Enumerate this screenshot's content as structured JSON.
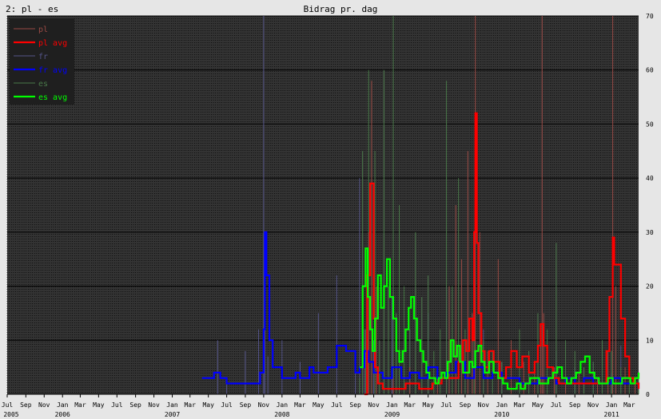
{
  "window": {
    "tab_label": "2: pl - es"
  },
  "chart_data": {
    "type": "line",
    "title": "Bidrag pr. dag",
    "xlabel": "",
    "ylabel": "",
    "ylim": [
      0,
      70
    ],
    "y_ticks": [
      0,
      10,
      20,
      30,
      40,
      50,
      60,
      70
    ],
    "grid": true,
    "legend_position": "top-left",
    "x_start": "2005-07",
    "x_end": "2011-04",
    "month_labels": [
      "Jul",
      "Sep",
      "Nov",
      "Jan",
      "Mar",
      "May",
      "Jul",
      "Sep",
      "Nov",
      "Jan",
      "Mar",
      "May",
      "Jul",
      "Sep",
      "Nov",
      "Jan",
      "Mar",
      "May",
      "Jul",
      "Sep",
      "Nov",
      "Jan",
      "Mar",
      "May",
      "Jul",
      "Sep",
      "Nov",
      "Jan",
      "Mar",
      "May",
      "Jul",
      "Sep",
      "Nov",
      "Jan",
      "Mar"
    ],
    "month_label_dates": [
      "2005-07",
      "2005-09",
      "2005-11",
      "2006-01",
      "2006-03",
      "2006-05",
      "2006-07",
      "2006-09",
      "2006-11",
      "2007-01",
      "2007-03",
      "2007-05",
      "2007-07",
      "2007-09",
      "2007-11",
      "2008-01",
      "2008-03",
      "2008-05",
      "2008-07",
      "2008-09",
      "2008-11",
      "2009-01",
      "2009-03",
      "2009-05",
      "2009-07",
      "2009-09",
      "2009-11",
      "2010-01",
      "2010-03",
      "2010-05",
      "2010-07",
      "2010-09",
      "2010-11",
      "2011-01",
      "2011-03"
    ],
    "year_labels": [
      "2005",
      "2006",
      "2007",
      "2008",
      "2009",
      "2010",
      "2011"
    ],
    "year_label_dates": [
      "2005-07",
      "2006-01",
      "2007-01",
      "2008-01",
      "2009-01",
      "2010-01",
      "2011-01"
    ],
    "colors": {
      "plot_bg": "#333333",
      "grid": "#000000",
      "pl": "#9a4a44",
      "pl_avg": "#ff0000",
      "fr": "#55558a",
      "fr_avg": "#0000ff",
      "es": "#4a7a4a",
      "es_avg": "#00ff00"
    },
    "series": [
      {
        "name": "pl",
        "key": "pl",
        "x": [
          "2008-10-01",
          "2008-10-15",
          "2008-10-25",
          "2008-11-10",
          "2009-01-05",
          "2009-03-01",
          "2009-06-01",
          "2009-07-10",
          "2009-08-01",
          "2009-08-20",
          "2009-09-10",
          "2009-09-25",
          "2009-10-05",
          "2009-10-20",
          "2009-11-15",
          "2009-12-20",
          "2010-02-01",
          "2010-03-15",
          "2010-04-20",
          "2010-05-10",
          "2010-05-15",
          "2010-05-20",
          "2010-06-25",
          "2010-08-01",
          "2010-09-15",
          "2010-11-15",
          "2010-12-20",
          "2011-01-05",
          "2011-01-15",
          "2011-02-15",
          "2011-03-20"
        ],
        "y": [
          0,
          30,
          58,
          20,
          3,
          5,
          3,
          20,
          35,
          25,
          45,
          15,
          70,
          30,
          8,
          25,
          10,
          6,
          5,
          12,
          70,
          15,
          5,
          3,
          4,
          3,
          8,
          70,
          20,
          5,
          3
        ]
      },
      {
        "name": "pl avg",
        "key": "pl_avg",
        "x": [
          "2008-10-01",
          "2008-10-10",
          "2008-10-20",
          "2008-11-01",
          "2008-11-05",
          "2008-11-15",
          "2008-12-01",
          "2009-01-01",
          "2009-02-15",
          "2009-04-01",
          "2009-05-15",
          "2009-06-15",
          "2009-07-15",
          "2009-08-10",
          "2009-08-25",
          "2009-09-05",
          "2009-09-15",
          "2009-09-25",
          "2009-10-01",
          "2009-10-05",
          "2009-10-10",
          "2009-10-15",
          "2009-10-25",
          "2009-11-05",
          "2009-11-20",
          "2009-12-05",
          "2009-12-25",
          "2010-01-15",
          "2010-02-01",
          "2010-02-20",
          "2010-03-10",
          "2010-04-01",
          "2010-04-20",
          "2010-05-01",
          "2010-05-10",
          "2010-05-20",
          "2010-06-01",
          "2010-06-20",
          "2010-07-10",
          "2010-08-01",
          "2010-09-01",
          "2010-10-01",
          "2010-11-01",
          "2010-12-01",
          "2010-12-15",
          "2010-12-25",
          "2011-01-05",
          "2011-01-10",
          "2011-01-20",
          "2011-02-01",
          "2011-02-15",
          "2011-03-01",
          "2011-03-15",
          "2011-04-01"
        ],
        "y": [
          0,
          22,
          39,
          14,
          5,
          2,
          1,
          1,
          2,
          1,
          2,
          3,
          3,
          6,
          10,
          8,
          14,
          10,
          30,
          52,
          28,
          15,
          8,
          5,
          8,
          6,
          3,
          5,
          8,
          5,
          7,
          4,
          6,
          9,
          13,
          9,
          5,
          3,
          2,
          2,
          2,
          2,
          2,
          2,
          8,
          18,
          29,
          24,
          24,
          14,
          7,
          3,
          2,
          1
        ]
      },
      {
        "name": "fr",
        "key": "fr",
        "x": [
          "2007-04-10",
          "2007-06-01",
          "2007-07-01",
          "2007-09-01",
          "2007-10-15",
          "2007-11-01",
          "2007-11-05",
          "2007-11-15",
          "2008-01-01",
          "2008-03-01",
          "2008-05-01",
          "2008-07-01",
          "2008-09-01",
          "2008-09-15",
          "2008-10-01",
          "2008-11-01",
          "2009-01-01",
          "2009-03-01",
          "2009-05-01",
          "2009-07-01",
          "2009-09-01",
          "2009-11-01",
          "2010-01-01",
          "2010-03-01",
          "2010-05-01",
          "2010-07-01",
          "2010-09-01",
          "2010-11-01",
          "2011-01-01",
          "2011-02-01",
          "2011-04-01"
        ],
        "y": [
          0,
          10,
          3,
          8,
          12,
          70,
          12,
          7,
          10,
          6,
          15,
          22,
          8,
          40,
          12,
          10,
          18,
          12,
          15,
          20,
          10,
          12,
          6,
          5,
          4,
          8,
          5,
          6,
          4,
          9,
          3
        ]
      },
      {
        "name": "fr avg",
        "key": "fr_avg",
        "x": [
          "2007-04-10",
          "2007-05-01",
          "2007-05-20",
          "2007-06-10",
          "2007-07-01",
          "2007-08-01",
          "2007-09-01",
          "2007-10-01",
          "2007-10-20",
          "2007-11-01",
          "2007-11-05",
          "2007-11-10",
          "2007-11-20",
          "2007-12-01",
          "2008-01-01",
          "2008-02-01",
          "2008-02-15",
          "2008-03-01",
          "2008-04-01",
          "2008-04-15",
          "2008-05-01",
          "2008-06-01",
          "2008-07-01",
          "2008-07-15",
          "2008-08-01",
          "2008-09-01",
          "2008-09-15",
          "2008-10-01",
          "2008-10-15",
          "2008-11-01",
          "2008-12-01",
          "2009-01-01",
          "2009-02-01",
          "2009-03-01",
          "2009-04-01",
          "2009-05-01",
          "2009-06-01",
          "2009-07-01",
          "2009-08-01",
          "2009-09-01",
          "2009-10-01",
          "2009-11-01",
          "2009-12-01",
          "2010-01-01",
          "2010-02-01",
          "2010-03-01",
          "2010-04-01",
          "2010-05-01",
          "2010-06-01",
          "2010-07-01",
          "2010-08-01",
          "2010-09-01",
          "2010-10-01",
          "2010-11-01",
          "2010-12-01",
          "2011-01-01",
          "2011-02-01",
          "2011-03-01",
          "2011-04-01"
        ],
        "y": [
          3,
          3,
          4,
          3,
          2,
          2,
          2,
          2,
          4,
          12,
          30,
          22,
          10,
          5,
          3,
          3,
          4,
          3,
          5,
          4,
          4,
          5,
          9,
          9,
          8,
          4,
          5,
          8,
          6,
          4,
          3,
          5,
          3,
          4,
          3,
          5,
          3,
          4,
          6,
          3,
          5,
          3,
          4,
          3,
          3,
          2,
          2,
          3,
          3,
          2,
          3,
          2,
          3,
          2,
          2,
          3,
          2,
          2,
          1
        ]
      },
      {
        "name": "es",
        "key": "es",
        "x": [
          "2008-09-15",
          "2008-09-25",
          "2008-10-05",
          "2008-10-15",
          "2008-10-25",
          "2008-11-05",
          "2008-11-20",
          "2008-12-05",
          "2008-12-20",
          "2009-01-05",
          "2009-01-15",
          "2009-01-25",
          "2009-02-10",
          "2009-03-01",
          "2009-03-20",
          "2009-04-10",
          "2009-05-01",
          "2009-05-20",
          "2009-06-10",
          "2009-07-01",
          "2009-07-20",
          "2009-08-10",
          "2009-09-01",
          "2009-10-01",
          "2009-11-01",
          "2009-12-01",
          "2010-01-01",
          "2010-02-01",
          "2010-03-01",
          "2010-04-01",
          "2010-05-01",
          "2010-06-01",
          "2010-07-01",
          "2010-08-01",
          "2010-09-01",
          "2010-10-01",
          "2010-11-01",
          "2010-12-01",
          "2011-01-01",
          "2011-02-01",
          "2011-03-01",
          "2011-04-01"
        ],
        "y": [
          3,
          45,
          12,
          60,
          25,
          45,
          10,
          60,
          20,
          70,
          15,
          35,
          20,
          12,
          30,
          18,
          22,
          8,
          12,
          58,
          20,
          40,
          12,
          15,
          10,
          8,
          6,
          10,
          12,
          8,
          15,
          12,
          28,
          10,
          8,
          5,
          6,
          10,
          8,
          5,
          6,
          4
        ]
      },
      {
        "name": "es avg",
        "key": "es_avg",
        "x": [
          "2008-09-15",
          "2008-09-25",
          "2008-10-05",
          "2008-10-12",
          "2008-10-20",
          "2008-10-28",
          "2008-11-05",
          "2008-11-15",
          "2008-11-25",
          "2008-12-05",
          "2008-12-15",
          "2008-12-25",
          "2009-01-05",
          "2009-01-15",
          "2009-01-25",
          "2009-02-05",
          "2009-02-15",
          "2009-02-25",
          "2009-03-05",
          "2009-03-15",
          "2009-03-25",
          "2009-04-05",
          "2009-04-15",
          "2009-04-25",
          "2009-05-05",
          "2009-05-15",
          "2009-05-25",
          "2009-06-05",
          "2009-06-15",
          "2009-06-25",
          "2009-07-05",
          "2009-07-15",
          "2009-07-25",
          "2009-08-05",
          "2009-08-15",
          "2009-08-25",
          "2009-09-05",
          "2009-09-15",
          "2009-09-25",
          "2009-10-05",
          "2009-10-15",
          "2009-10-25",
          "2009-11-05",
          "2009-11-20",
          "2009-12-05",
          "2009-12-20",
          "2010-01-05",
          "2010-01-20",
          "2010-02-05",
          "2010-02-20",
          "2010-03-05",
          "2010-03-20",
          "2010-04-05",
          "2010-04-20",
          "2010-05-05",
          "2010-05-20",
          "2010-06-05",
          "2010-06-20",
          "2010-07-05",
          "2010-07-20",
          "2010-08-05",
          "2010-08-20",
          "2010-09-05",
          "2010-09-20",
          "2010-10-05",
          "2010-10-20",
          "2010-11-05",
          "2010-11-20",
          "2010-12-05",
          "2010-12-20",
          "2011-01-05",
          "2011-01-20",
          "2011-02-05",
          "2011-02-20",
          "2011-03-05",
          "2011-03-20",
          "2011-04-01"
        ],
        "y": [
          5,
          20,
          27,
          18,
          12,
          8,
          14,
          22,
          16,
          20,
          25,
          18,
          14,
          8,
          6,
          8,
          12,
          16,
          18,
          14,
          10,
          8,
          6,
          4,
          3,
          3,
          2,
          3,
          4,
          3,
          6,
          10,
          7,
          9,
          6,
          4,
          4,
          6,
          5,
          8,
          9,
          6,
          4,
          6,
          4,
          3,
          2,
          1,
          1,
          2,
          1,
          2,
          3,
          3,
          2,
          2,
          3,
          4,
          5,
          3,
          2,
          3,
          4,
          6,
          7,
          4,
          3,
          2,
          2,
          3,
          2,
          2,
          3,
          3,
          2,
          3,
          4
        ]
      }
    ]
  }
}
